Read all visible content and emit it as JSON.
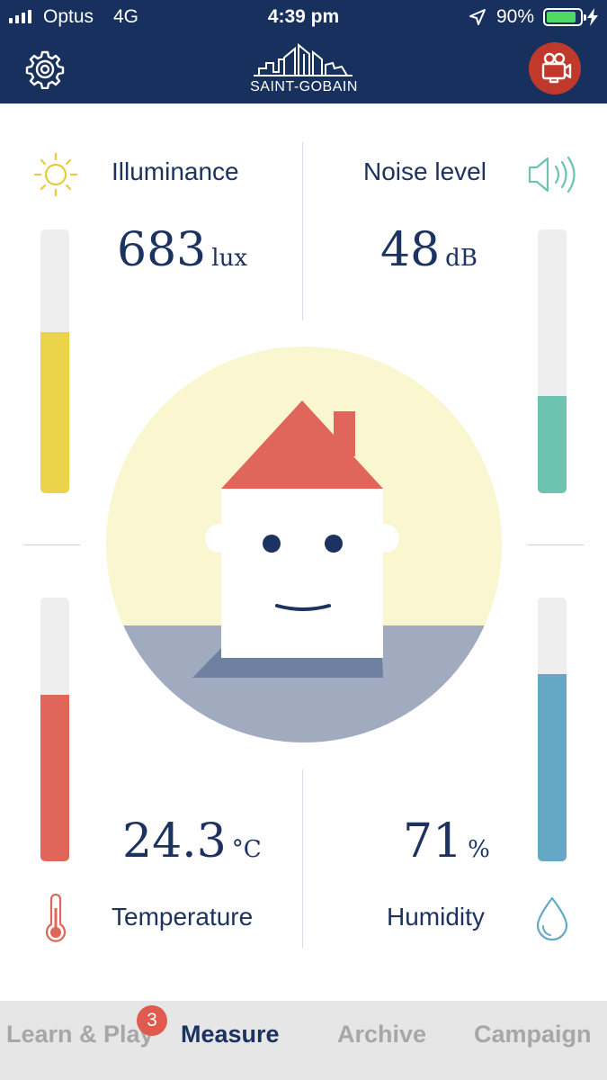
{
  "status_bar": {
    "carrier": "Optus",
    "network": "4G",
    "time": "4:39 pm",
    "battery_percent": "90%",
    "battery_level": 0.9,
    "signal_bars": 4
  },
  "header": {
    "brand": "SAINT-GOBAIN",
    "settings_icon": "gear-icon",
    "camera_icon": "video-camera-icon",
    "camera_color": "#c0392b"
  },
  "metrics": {
    "illuminance": {
      "label": "Illuminance",
      "value": "683",
      "unit": "lux",
      "level": 0.61,
      "color": "#ebd34a",
      "icon": "sun-icon"
    },
    "noise": {
      "label": "Noise level",
      "value": "48",
      "unit": "dB",
      "level": 0.37,
      "color": "#6cc3b0",
      "icon": "speaker-icon"
    },
    "temperature": {
      "label": "Temperature",
      "value": "24.3",
      "unit": "°C",
      "level": 0.63,
      "color": "#e0655a",
      "icon": "thermometer-icon"
    },
    "humidity": {
      "label": "Humidity",
      "value": "71",
      "unit": "%",
      "level": 0.71,
      "color": "#64a8c6",
      "icon": "water-drop-icon"
    }
  },
  "tabs": [
    {
      "label": "Learn & Play",
      "badge": "3",
      "active": false
    },
    {
      "label": "Measure",
      "active": true
    },
    {
      "label": "Archive",
      "active": false
    },
    {
      "label": "Campaign",
      "active": false
    }
  ],
  "colors": {
    "header": "#17305e",
    "text": "#1c3260",
    "inactive_tab": "#a7a7a7",
    "badge": "#e05a4f"
  }
}
